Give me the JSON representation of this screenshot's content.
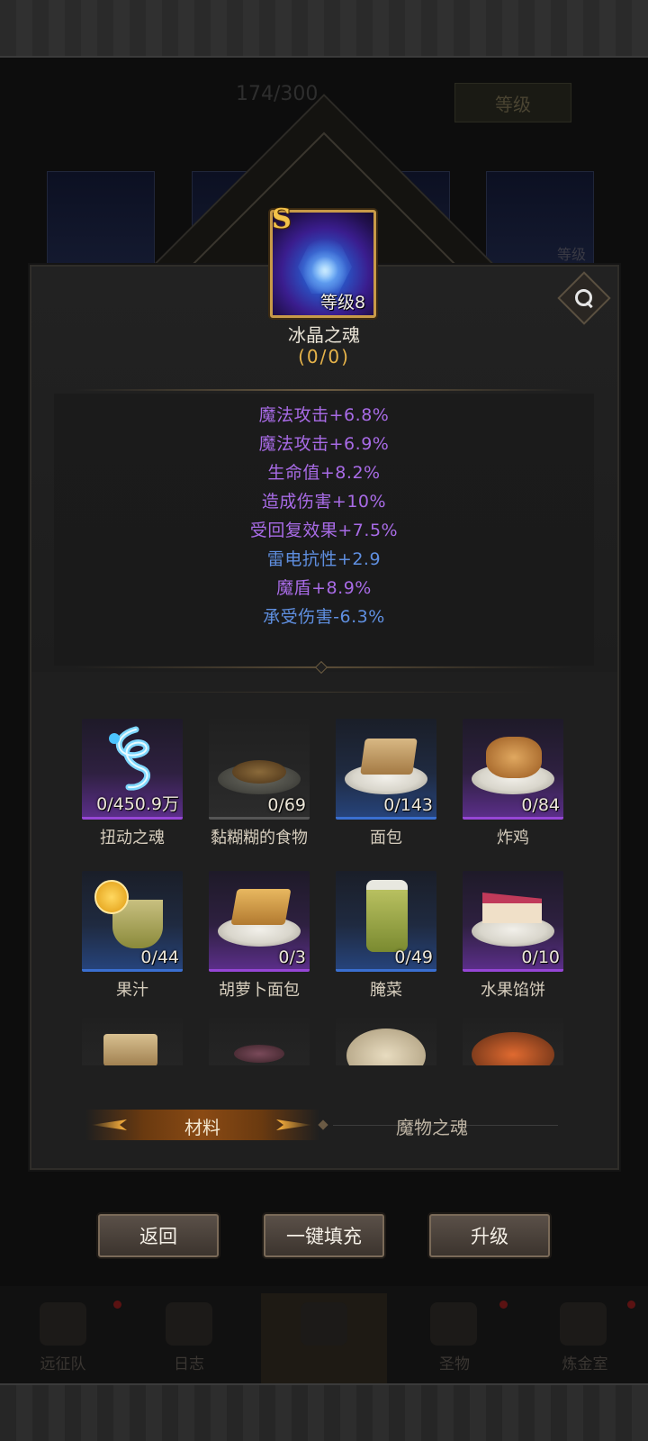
{
  "background": {
    "count_text": "174/300",
    "level_button": "等级",
    "card_level_label": "等级"
  },
  "soul": {
    "rank": "S",
    "level": "等级8",
    "name": "冰晶之魂",
    "count": "(0/0)"
  },
  "stats": [
    {
      "text": "魔法攻击+6.8%",
      "color": "purple"
    },
    {
      "text": "魔法攻击+6.9%",
      "color": "purple"
    },
    {
      "text": "生命值+8.2%",
      "color": "purple"
    },
    {
      "text": "造成伤害+10%",
      "color": "purple"
    },
    {
      "text": "受回复效果+7.5%",
      "color": "purple"
    },
    {
      "text": "雷电抗性+2.9",
      "color": "blue"
    },
    {
      "text": "魔盾+8.9%",
      "color": "purple"
    },
    {
      "text": "承受伤害-6.3%",
      "color": "blue"
    }
  ],
  "materials": [
    {
      "name": "扭动之魂",
      "qty": "0/450.9万",
      "rarity": "purple",
      "icon": "twisting-soul-icon"
    },
    {
      "name": "黏糊糊的食物",
      "qty": "0/69",
      "rarity": "gray",
      "icon": "sticky-food-icon"
    },
    {
      "name": "面包",
      "qty": "0/143",
      "rarity": "blue",
      "icon": "bread-icon"
    },
    {
      "name": "炸鸡",
      "qty": "0/84",
      "rarity": "purple",
      "icon": "fried-chicken-icon"
    },
    {
      "name": "果汁",
      "qty": "0/44",
      "rarity": "blue",
      "icon": "juice-icon"
    },
    {
      "name": "胡萝卜面包",
      "qty": "0/3",
      "rarity": "purple",
      "icon": "carrot-bread-icon"
    },
    {
      "name": "腌菜",
      "qty": "0/49",
      "rarity": "blue",
      "icon": "pickles-icon"
    },
    {
      "name": "水果馅饼",
      "qty": "0/10",
      "rarity": "purple",
      "icon": "fruit-pie-icon"
    }
  ],
  "tabs": {
    "active": "材料",
    "inactive": "魔物之魂"
  },
  "buttons": {
    "back": "返回",
    "auto_fill": "一键填充",
    "upgrade": "升级"
  },
  "nav": [
    "远征队",
    "日志",
    "",
    "圣物",
    "炼金室"
  ],
  "colors": {
    "stat_purple": "#a86be6",
    "stat_blue": "#5f8fe0",
    "rarity_purple": "#9646d6",
    "rarity_blue": "#3a6fd0",
    "gold": "#e7b44a"
  }
}
